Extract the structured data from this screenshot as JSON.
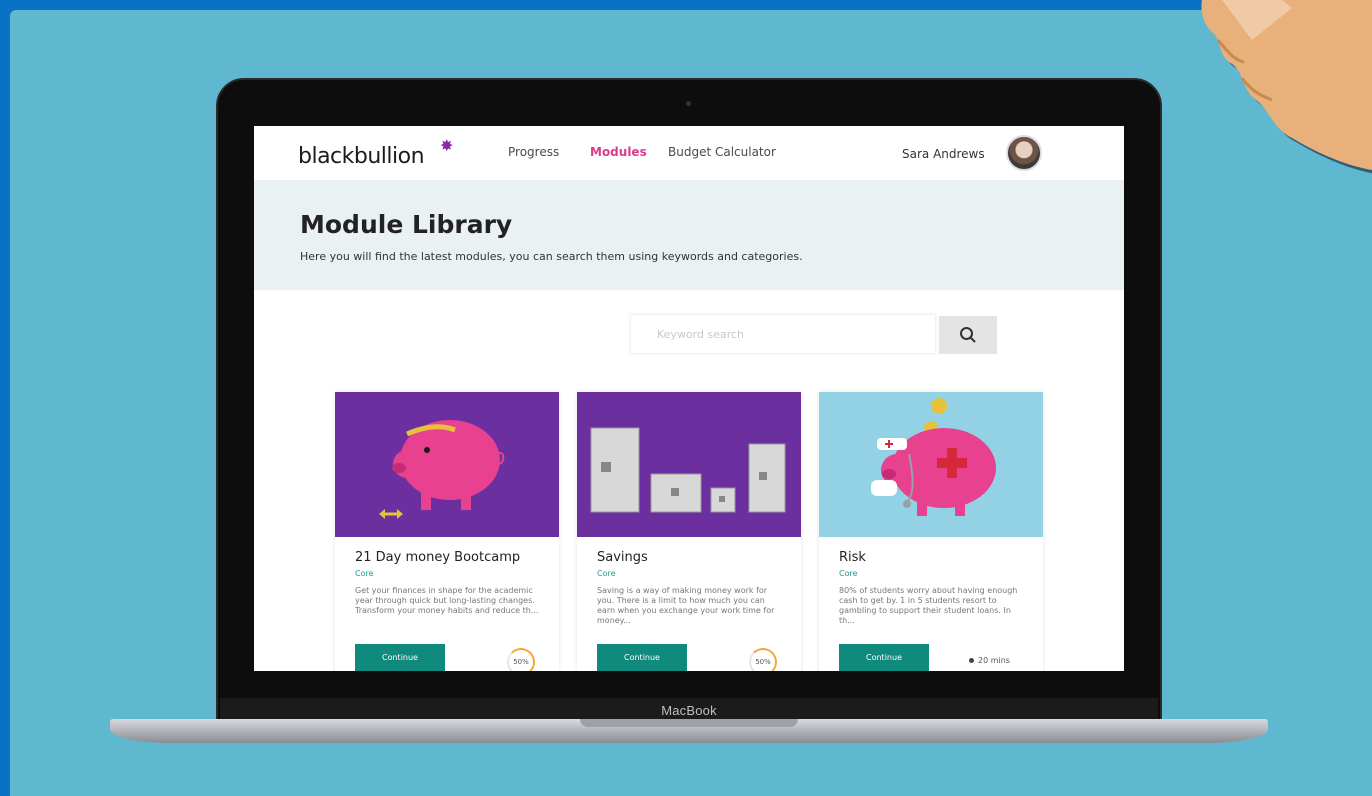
{
  "laptop": {
    "brand_label": "MacBook"
  },
  "nav": {
    "logo": "blackbullion",
    "links": [
      "Progress",
      "Modules",
      "Budget Calculator"
    ],
    "active_link": "Modules",
    "user_name": "Sara Andrews"
  },
  "hero": {
    "title": "Module Library",
    "subtitle": "Here you will find the latest modules, you can search them using keywords and categories."
  },
  "search": {
    "placeholder": "Keyword search"
  },
  "cards": [
    {
      "title": "21 Day money Bootcamp",
      "category": "Core",
      "description": "Get your finances in shape for the academic year through quick but long-lasting changes. Transform your money habits and reduce th...",
      "button": "Continue",
      "progress_label": "50%",
      "progress": 0.5
    },
    {
      "title": "Savings",
      "category": "Core",
      "description": "Saving is a way of making money work for you. There is a limit to how much you can earn when you exchange your work time for money...",
      "button": "Continue",
      "progress_label": "50%",
      "progress": 0.5
    },
    {
      "title": "Risk",
      "category": "Core",
      "description": "80% of students worry about having enough cash to get by. 1 in 5 students resort to gambling to support their student loans. In th...",
      "button": "Continue",
      "duration": "20 mins"
    }
  ],
  "colors": {
    "outer_border": "#0a72c4",
    "background": "#5fb8cf",
    "accent": "#e0398c",
    "button": "#118a7e",
    "card_purple": "#6b2fa0",
    "card_blue": "#93d2e5"
  }
}
